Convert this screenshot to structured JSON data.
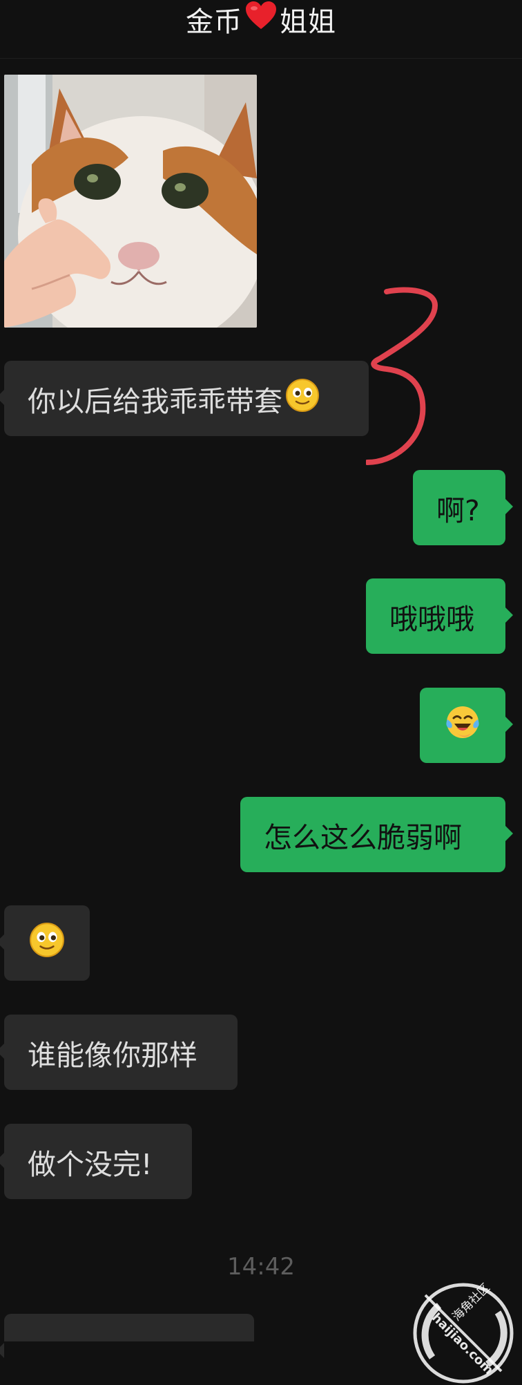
{
  "header": {
    "title_left": "金币",
    "title_right": "姐姐",
    "heart_icon": "red-heart-icon"
  },
  "messages": [
    {
      "type": "image",
      "direction": "incoming",
      "content": "cat-pointing-sticker"
    },
    {
      "type": "text",
      "direction": "incoming",
      "text": "你以后给我乖乖带套",
      "trailing_emoji": "smile-emoji"
    },
    {
      "type": "text",
      "direction": "outgoing",
      "text": "啊?"
    },
    {
      "type": "text",
      "direction": "outgoing",
      "text": "哦哦哦"
    },
    {
      "type": "emoji",
      "direction": "outgoing",
      "emoji": "laugh-cry-emoji"
    },
    {
      "type": "text",
      "direction": "outgoing",
      "text": "怎么这么脆弱啊"
    },
    {
      "type": "emoji",
      "direction": "incoming",
      "emoji": "smile-emoji"
    },
    {
      "type": "text",
      "direction": "incoming",
      "text": "谁能像你那样"
    },
    {
      "type": "text",
      "direction": "incoming",
      "text": "做个没完!"
    }
  ],
  "timestamp": "14:42",
  "annotation": {
    "glyph": "3",
    "color": "#e0424e"
  },
  "watermark": {
    "text_cn": "海角社区",
    "text_en": "haijiao.com"
  },
  "colors": {
    "background": "#111111",
    "incoming_bubble": "#2a2a2a",
    "outgoing_bubble": "#27ae5a",
    "timestamp": "#5d5d5d"
  }
}
